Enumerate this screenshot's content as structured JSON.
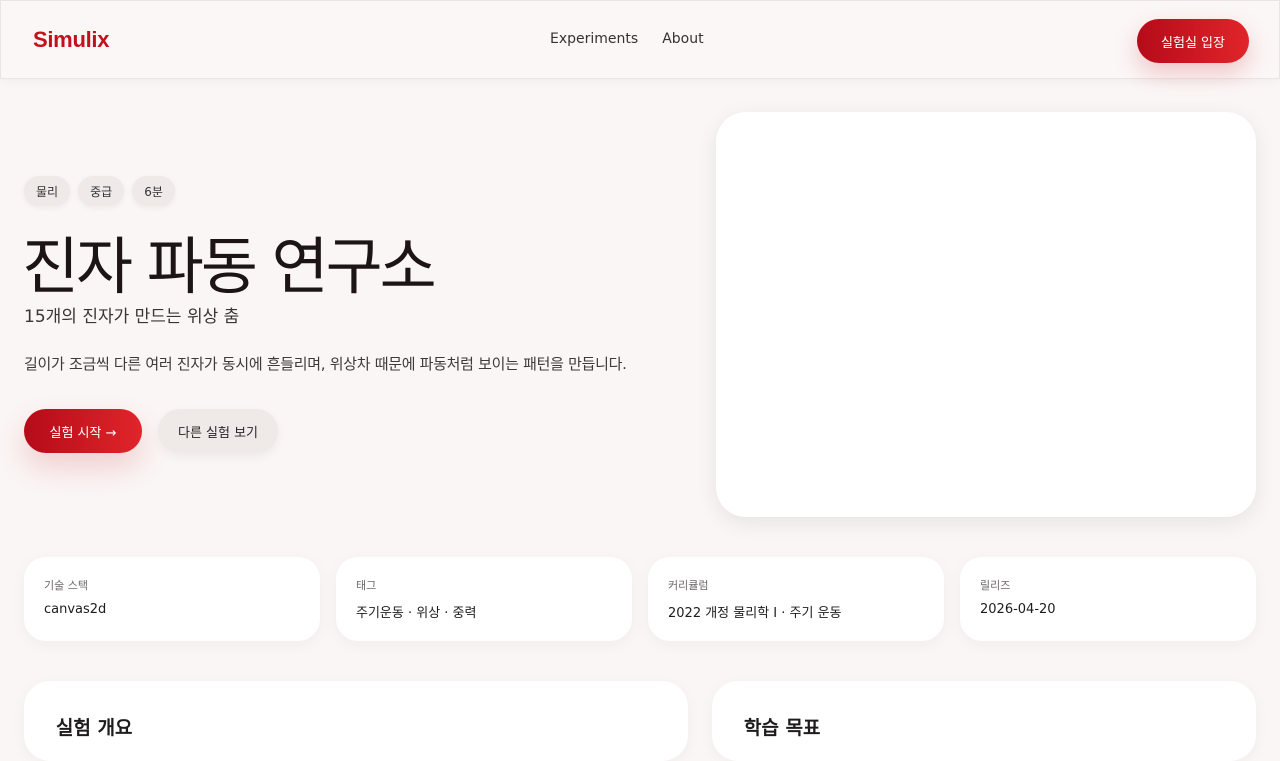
{
  "nav": {
    "logo": "Simulix",
    "links": [
      "Experiments",
      "About"
    ],
    "enter_label": "실험실 입장"
  },
  "hero": {
    "tags": [
      "물리",
      "중급",
      "6분"
    ],
    "title": "진자 파동 연구소",
    "subtitle": "15개의 진자가 만드는 위상 춤",
    "description": "길이가 조금씩 다른 여러 진자가 동시에 흔들리며, 위상차 때문에 파동처럼 보이는 패턴을 만듭니다.",
    "start_label": "실험 시작 →",
    "other_label": "다른 실험 보기"
  },
  "info": [
    {
      "label": "기술 스택",
      "value": "canvas2d"
    },
    {
      "label": "태그",
      "value": "주기운동 · 위상 · 중력"
    },
    {
      "label": "커리큘럼",
      "value": "2022 개정 물리학 I · 주기 운동"
    },
    {
      "label": "릴리즈",
      "value": "2026-04-20"
    }
  ],
  "sections": {
    "left_title": "실험 개요",
    "right_title": "학습 목표"
  },
  "colors": {
    "accent": "#c5101c",
    "background": "#faf6f5"
  }
}
